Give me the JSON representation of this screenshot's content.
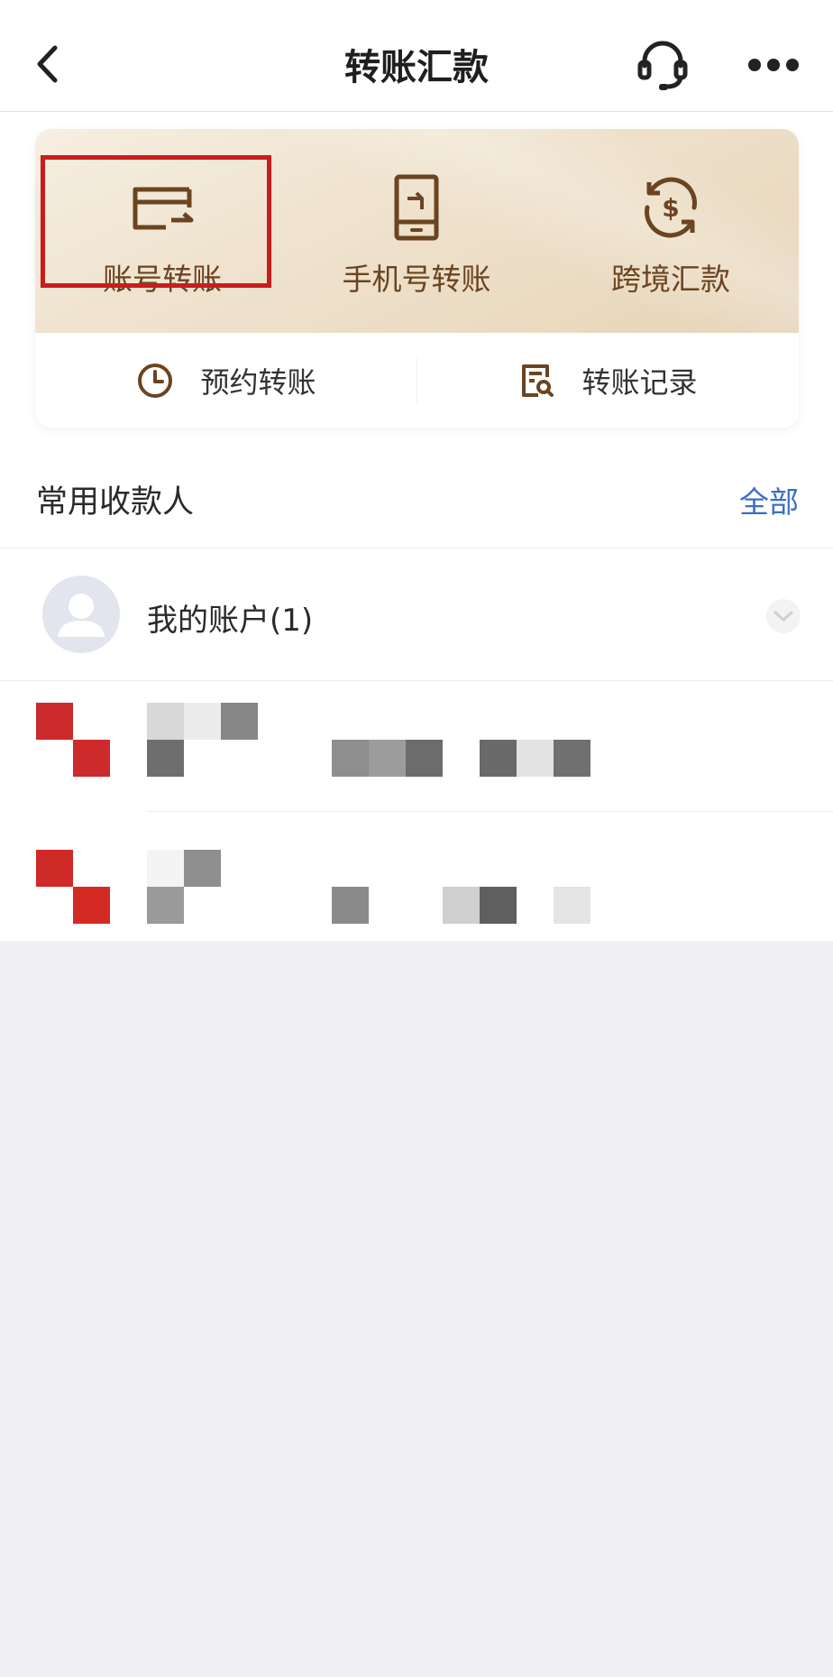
{
  "header": {
    "title": "转账汇款",
    "back_icon": "chevron-left-icon",
    "service_icon": "headset-icon",
    "more_icon": "more-dots-icon"
  },
  "quick_actions": [
    {
      "label": "账号转账",
      "icon": "card-transfer-icon",
      "highlighted": true
    },
    {
      "label": "手机号转账",
      "icon": "phone-transfer-icon",
      "highlighted": false
    },
    {
      "label": "跨境汇款",
      "icon": "dollar-exchange-icon",
      "highlighted": false
    }
  ],
  "sub_actions": [
    {
      "label": "预约转账",
      "icon": "clock-icon"
    },
    {
      "label": "转账记录",
      "icon": "record-search-icon"
    }
  ],
  "frequent_payees": {
    "title": "常用收款人",
    "view_all": "全部",
    "my_account_label": "我的账户(1)"
  },
  "colors": {
    "accent_brown": "#6b4421",
    "highlight_red": "#c81d1d",
    "link_blue": "#3c6cc7"
  }
}
